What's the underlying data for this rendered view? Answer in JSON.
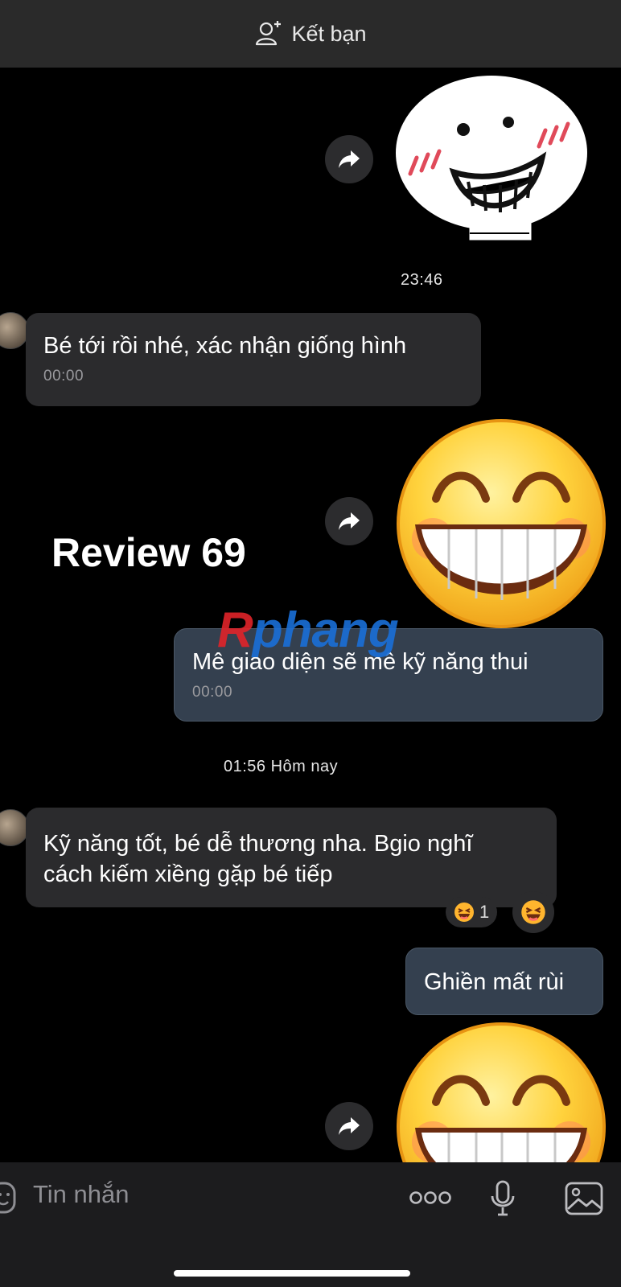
{
  "header": {
    "add_friend_label": "Kết bạn"
  },
  "messages": {
    "time_1": "23:46",
    "msg_1": {
      "text": "Bé tới rồi nhé, xác nhận giống hình",
      "time": "00:00"
    },
    "msg_2": {
      "text": "Mê giao diện sẽ mê kỹ năng thui",
      "time": "00:00"
    },
    "time_2": "01:56 Hôm nay",
    "msg_3": {
      "text_line1": "Kỹ năng tốt, bé dễ thương nha. Bgio nghĩ",
      "text_line2": "cách kiếm xiềng gặp bé tiếp",
      "reaction_count": "1"
    },
    "msg_4": {
      "text": "Ghiền mất rùi"
    }
  },
  "overlay": {
    "review_text": "Review 69",
    "watermark_part1": "R",
    "watermark_part2": "phang"
  },
  "composer": {
    "placeholder": "Tin nhắn"
  },
  "icons": {
    "forward": "forward-icon",
    "sticker": "sticker-icon",
    "more": "more-icon",
    "mic": "microphone-icon",
    "image": "image-icon",
    "add_friend": "add-friend-icon"
  },
  "colors": {
    "background": "#000000",
    "incoming_bubble": "#2b2b2d",
    "outgoing_bubble": "#34404f"
  }
}
